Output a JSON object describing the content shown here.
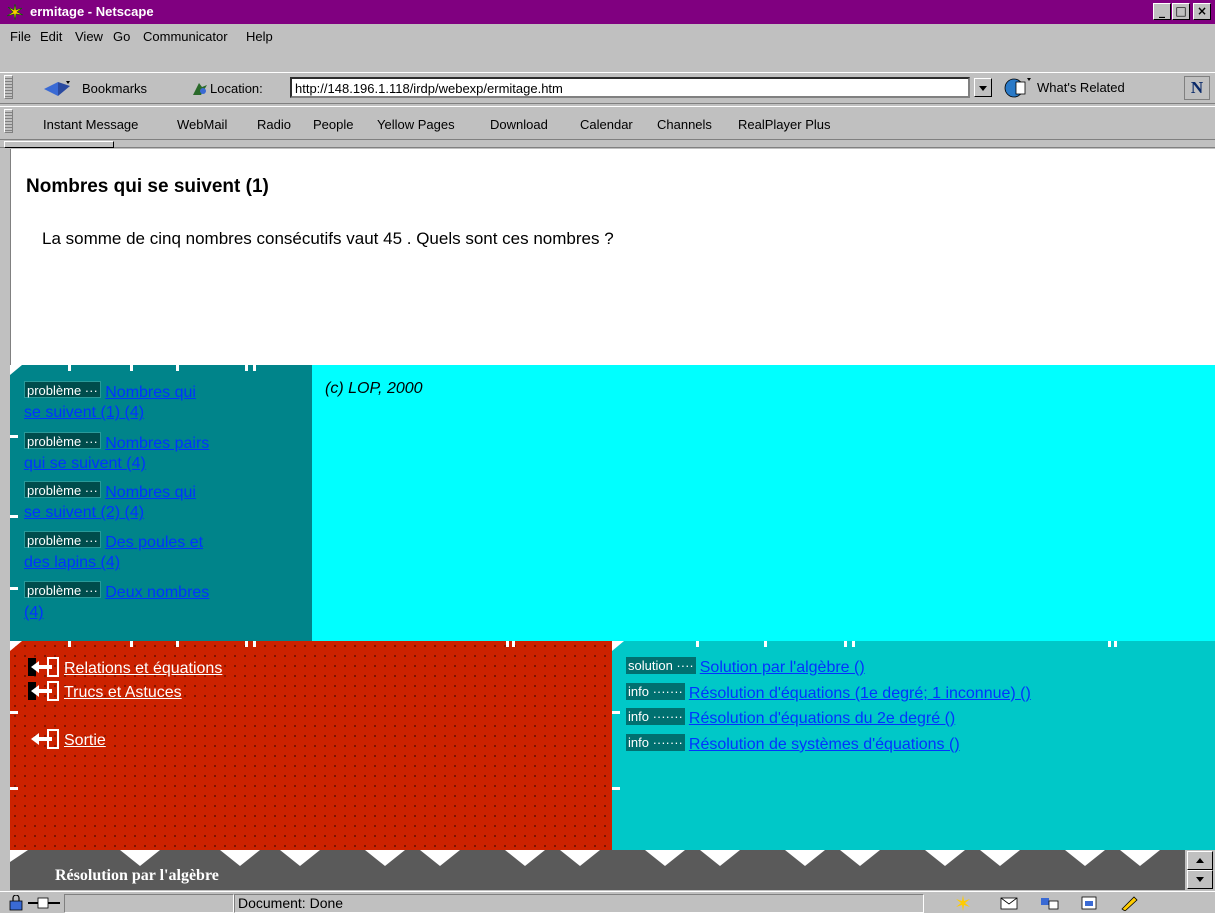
{
  "window": {
    "title": "ermitage - Netscape",
    "min": "_",
    "max": "□",
    "close": "×"
  },
  "menu": [
    "File",
    "Edit",
    "View",
    "Go",
    "Communicator",
    "Help"
  ],
  "nav_toolbar": {
    "bookmarks": "Bookmarks",
    "location_label": "Location:",
    "location_value": "http://148.196.1.118/irdp/webexp/ermitage.htm",
    "whats_related": "What's Related",
    "logo": "N"
  },
  "personal_toolbar": [
    "Instant Message",
    "WebMail",
    "Radio",
    "People",
    "Yellow Pages",
    "Download",
    "Calendar",
    "Channels",
    "RealPlayer Plus"
  ],
  "problem": {
    "heading": "Nombres qui se suivent (1)",
    "statement": "La somme de cinq nombres consécutifs vaut 45 . Quels sont ces nombres ?"
  },
  "problem_list": {
    "tag": "problème ···",
    "items": [
      {
        "line1": "Nombres qui",
        "line2": "se suivent (1) (4)"
      },
      {
        "line1": "Nombres pairs",
        "line2": "qui se suivent (4)"
      },
      {
        "line1": "Nombres qui",
        "line2": "se suivent (2) (4)"
      },
      {
        "line1": "Des poules et",
        "line2": "des lapins (4)"
      },
      {
        "line1": "Deux nombres",
        "line2": "(4)"
      }
    ]
  },
  "copyright": "(c) LOP, 2000",
  "nav_links": [
    "Relations et équations",
    "Trucs et Astuces",
    "Sortie"
  ],
  "resources": [
    {
      "tag": "solution ····",
      "label": "Solution par l'algèbre ()"
    },
    {
      "tag": "info ·······",
      "label": "Résolution d'équations (1e degré; 1 inconnue) ()"
    },
    {
      "tag": "info ·······",
      "label": "Résolution d'équations du 2e degré ()"
    },
    {
      "tag": "info ·······",
      "label": "Résolution de systèmes d'équations ()"
    }
  ],
  "banner_title": "Résolution par l'algèbre",
  "status": "Document: Done",
  "colors": {
    "titlebar": "#800080",
    "teal": "#00848a",
    "cyan": "#00ffff",
    "red": "#cc2200",
    "teal2": "#00c8c8",
    "link": "#0033ff"
  }
}
